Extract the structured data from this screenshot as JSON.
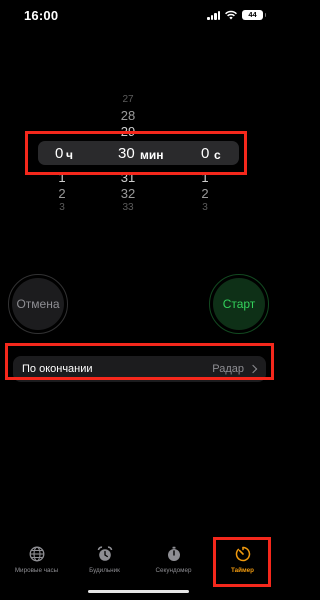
{
  "status_bar": {
    "time": "16:00",
    "battery": "44"
  },
  "picker": {
    "hours": {
      "above": [
        "",
        "",
        ""
      ],
      "selected": "0",
      "unit": "ч",
      "below": [
        "1",
        "2",
        "3"
      ]
    },
    "minutes": {
      "above": [
        "27",
        "28",
        "29"
      ],
      "selected": "30",
      "unit": "мин",
      "below": [
        "31",
        "32",
        "33"
      ]
    },
    "seconds": {
      "above": [
        "",
        "",
        ""
      ],
      "selected": "0",
      "unit": "с",
      "below": [
        "1",
        "2",
        "3"
      ]
    }
  },
  "buttons": {
    "cancel": "Отмена",
    "start": "Старт"
  },
  "end_row": {
    "label": "По окончании",
    "value": "Радар"
  },
  "tabs": [
    {
      "label": "Мировые часы",
      "icon": "globe-icon"
    },
    {
      "label": "Будильник",
      "icon": "alarm-clock-icon"
    },
    {
      "label": "Секундомер",
      "icon": "stopwatch-icon"
    },
    {
      "label": "Таймер",
      "icon": "timer-icon",
      "active": true
    }
  ],
  "colors": {
    "accent": "#f19a0e",
    "start_green": "#33d15b",
    "highlight_red": "#f5281c"
  }
}
